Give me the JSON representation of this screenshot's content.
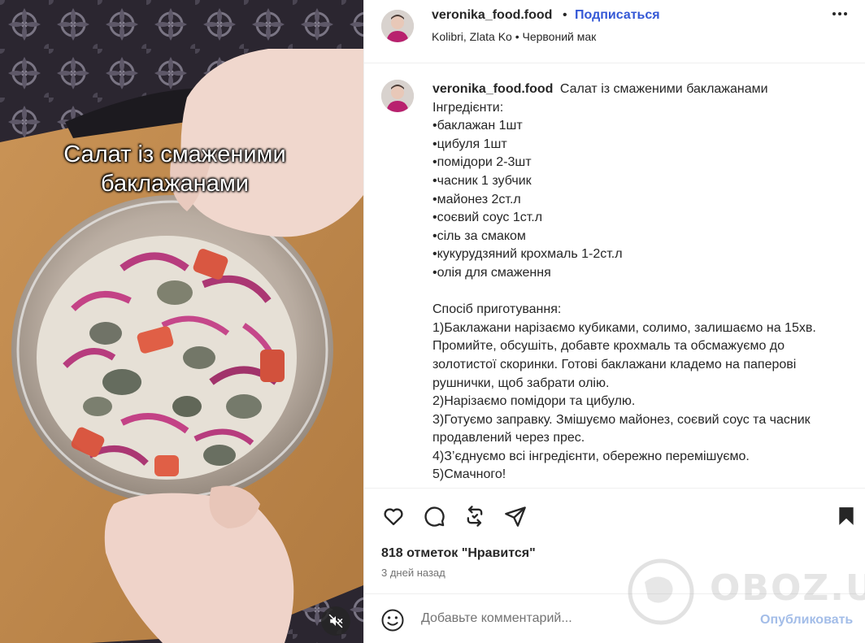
{
  "media": {
    "overlay_title": "Салат із смаженими\nбаклажанами"
  },
  "post": {
    "username": "veronika_food.food",
    "follow_label": "Подписаться",
    "audio": "Kolibri, Zlata Ko • Червоний мак",
    "separator": "•"
  },
  "caption": {
    "username": "veronika_food.food",
    "title": "Салат із смаженими баклажанами",
    "lines": [
      "Інгредієнти:",
      "•баклажан 1шт",
      "•цибуля 1шт",
      "•помідори 2-3шт",
      "•часник 1 зубчик",
      "•майонез 2ст.л",
      "•соєвий соус 1ст.л",
      "•сіль за смаком",
      "•кукурудзяний крохмаль 1-2ст.л",
      "•олія для смаження",
      "",
      "Спосіб приготування:",
      "1)Баклажани нарізаємо кубиками, солимо, залишаємо на 15хв. Промийте, обсушіть, добавте крохмаль та обсмажуємо до золотистої скоринки. Готові баклажани кладемо на паперові рушнички, щоб забрати олію.",
      "2)Нарізаємо помідори та цибулю.",
      "3)Готуємо заправку. Змішуємо майонез, соєвий соус та часник продавлений через прес.",
      "4)З’єднуємо всі інгредієнти, обережно перемішуємо.",
      "5)Смачного!"
    ]
  },
  "actions": {
    "icons": [
      "heart-icon",
      "comment-icon",
      "repost-icon",
      "share-icon",
      "bookmark-icon"
    ],
    "likes": "818 отметок \"Нравится\"",
    "time_ago": "3 дней назад"
  },
  "comment": {
    "placeholder": "Добавьте комментарий...",
    "publish_label": "Опубликовать"
  },
  "watermark": {
    "text": "OBOZ.UA"
  },
  "colors": {
    "link": "#3458d6",
    "publish_disabled": "#a3bde8",
    "text": "#262626",
    "muted": "#737373",
    "divider": "#efefef"
  }
}
